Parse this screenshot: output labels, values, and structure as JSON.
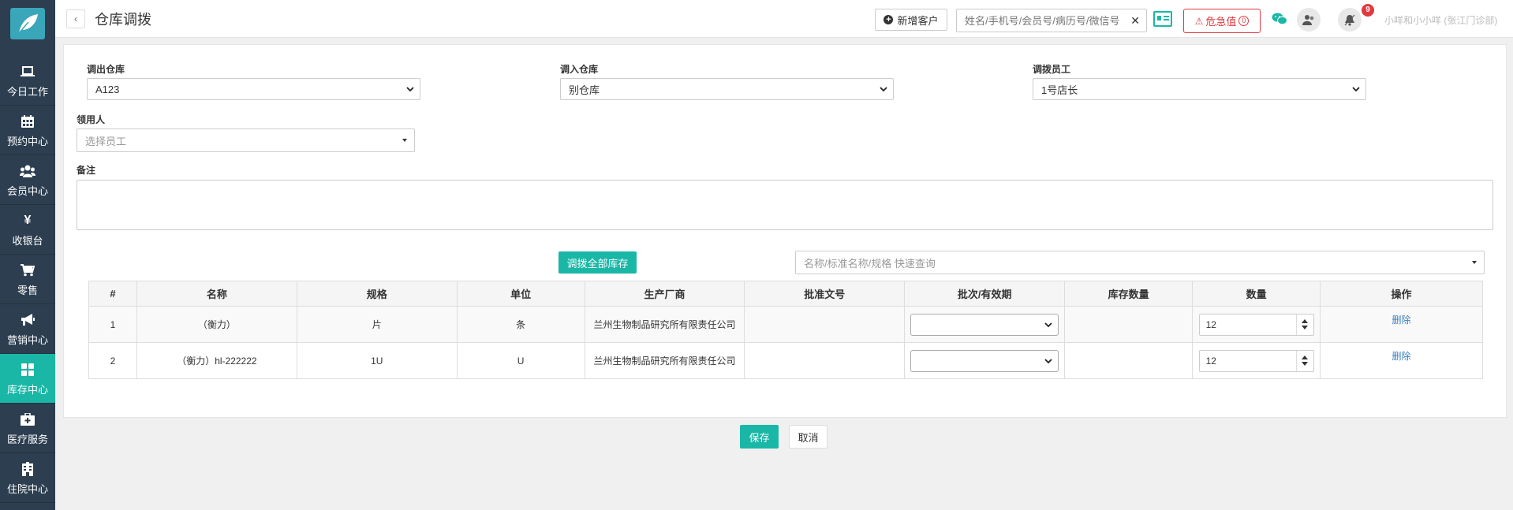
{
  "sidebar": {
    "items": [
      {
        "label": "今日工作",
        "icon": "laptop-icon",
        "active": false
      },
      {
        "label": "预约中心",
        "icon": "calendar-icon",
        "active": false
      },
      {
        "label": "会员中心",
        "icon": "users-icon",
        "active": false
      },
      {
        "label": "收银台",
        "icon": "yen-icon",
        "active": false
      },
      {
        "label": "零售",
        "icon": "cart-icon",
        "active": false
      },
      {
        "label": "营销中心",
        "icon": "megaphone-icon",
        "active": false
      },
      {
        "label": "库存中心",
        "icon": "grid-icon",
        "active": true
      },
      {
        "label": "医疗服务",
        "icon": "medkit-icon",
        "active": false
      },
      {
        "label": "住院中心",
        "icon": "building-icon",
        "active": false
      }
    ]
  },
  "header": {
    "title": "仓库调拨",
    "new_customer_label": "新增客户",
    "search_placeholder": "姓名/手机号/会员号/病历号/微信号",
    "clear_symbol": "✕",
    "danger_label": "危急值",
    "danger_count": "0",
    "notification_count": "9",
    "user_name": "小咩和小小咩 (张江门诊部)"
  },
  "form": {
    "out_warehouse_label": "调出仓库",
    "out_warehouse_value": "A123",
    "in_warehouse_label": "调入仓库",
    "in_warehouse_value": "别仓库",
    "staff_label": "调拨员工",
    "staff_value": "1号店长",
    "receiver_label": "领用人",
    "receiver_placeholder": "选择员工",
    "remark_label": "备注",
    "remark_value": ""
  },
  "actions": {
    "transfer_all_label": "调拨全部库存",
    "quick_search_placeholder": "名称/标准名称/规格 快速查询",
    "save_label": "保存",
    "cancel_label": "取消"
  },
  "table": {
    "headers": [
      "#",
      "名称",
      "规格",
      "单位",
      "生产厂商",
      "批准文号",
      "批次/有效期",
      "库存数量",
      "数量",
      "操作"
    ],
    "rows": [
      {
        "index": "1",
        "name": "（衡力）",
        "spec": "片",
        "unit": "条",
        "maker": "兰州生物制品研究所有限责任公司",
        "approval": "",
        "batch": "",
        "stock": "",
        "qty": "12",
        "op": "删除"
      },
      {
        "index": "2",
        "name": "（衡力）hl-222222",
        "spec": "1U",
        "unit": "U",
        "maker": "兰州生物制品研究所有限责任公司",
        "approval": "",
        "batch": "",
        "stock": "",
        "qty": "12",
        "op": "删除"
      }
    ]
  },
  "colors": {
    "accent": "#1ab7a6",
    "sidebar": "#2c3e50",
    "danger": "#e0393e",
    "link": "#3a7fc2"
  }
}
